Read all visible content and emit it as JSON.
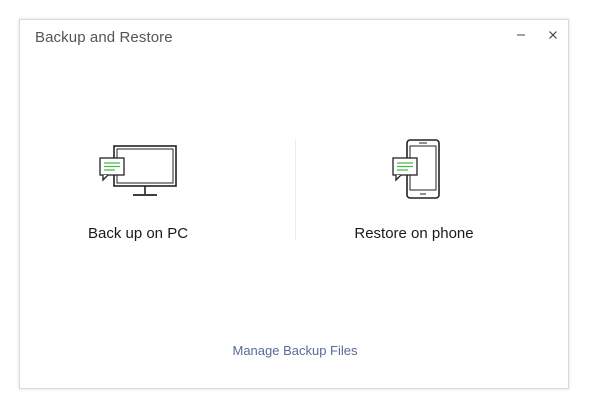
{
  "window": {
    "title": "Backup and Restore"
  },
  "controls": {
    "minimize_icon": "minimize-icon",
    "close_icon": "close-icon"
  },
  "options": [
    {
      "label": "Back up on PC",
      "icon": "computer-chat-icon"
    },
    {
      "label": "Restore on phone",
      "icon": "phone-chat-icon"
    }
  ],
  "footer": {
    "manage_link": "Manage Backup Files"
  },
  "colors": {
    "accent_green": "#3fb83f",
    "link": "#576b95"
  }
}
